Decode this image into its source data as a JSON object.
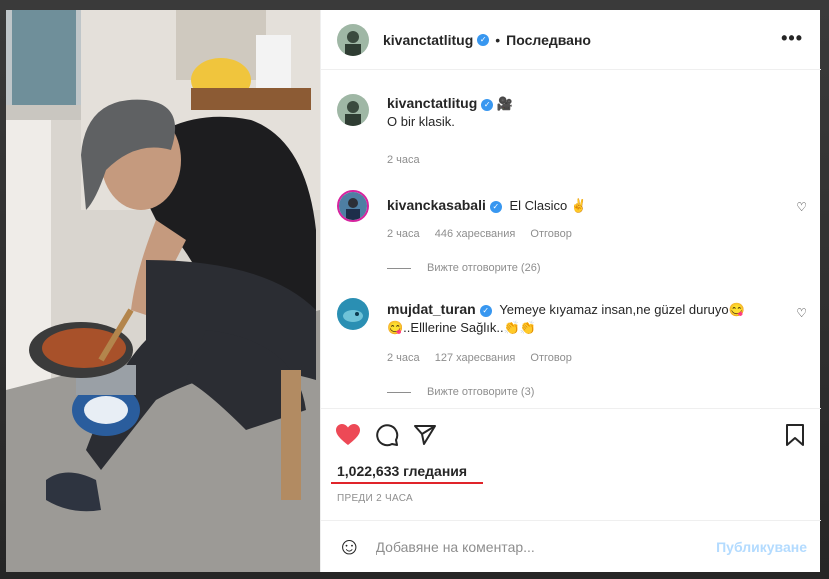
{
  "header": {
    "username": "kivanctatlitug",
    "separator": "•",
    "follow_label": "Последвано",
    "more_label": "•••"
  },
  "caption": {
    "username": "kivanctatlitug",
    "camera_glyph": "🎥",
    "text": "O bir klasik.",
    "time": "2 часа"
  },
  "comments": [
    {
      "username": "kivanckasabali",
      "text": "El Clasico ✌",
      "time": "2 часа",
      "likes": "446 харесвания",
      "reply_label": "Отговор",
      "view_replies": "Вижте отговорите (26)"
    },
    {
      "username": "mujdat_turan",
      "text": "Yemeye kıyamaz insan,ne güzel duruyo😋",
      "text2": "😋..Elllerine Sağlık..👏👏",
      "time": "2 часа",
      "likes": "127 харесвания",
      "reply_label": "Отговор",
      "view_replies": "Вижте отговорите (3)"
    }
  ],
  "actions": {
    "views": "1,022,633 гледания",
    "posted_ago": "ПРЕДИ 2 ЧАСА"
  },
  "add_comment": {
    "placeholder": "Добавяне на коментар...",
    "post_label": "Публикуване",
    "emoji_glyph": "☺"
  },
  "colors": {
    "like_red": "#ed4956",
    "verified_blue": "#3897f0",
    "annotation_red": "#e0242a",
    "post_disabled": "#b3dbff"
  },
  "icons": [
    "heart-icon",
    "comment-icon",
    "share-icon",
    "bookmark-icon",
    "emoji-icon",
    "more-icon",
    "verified-icon"
  ]
}
